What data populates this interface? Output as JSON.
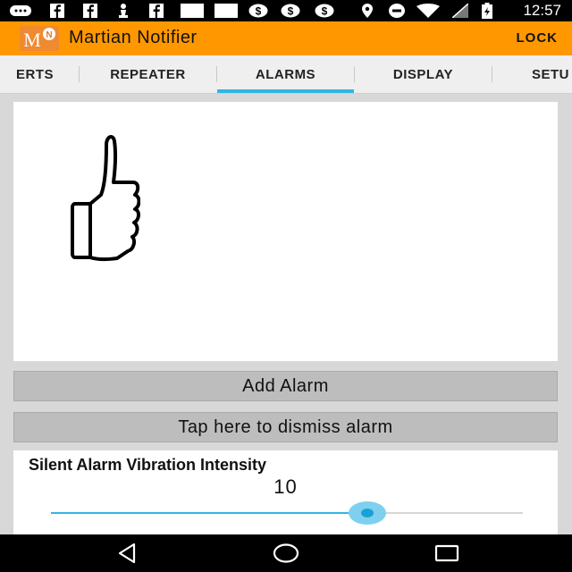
{
  "status_bar": {
    "time": "12:57",
    "icons": [
      "message-icon",
      "facebook-icon",
      "facebook-icon",
      "chess-icon",
      "facebook-icon",
      "image-icon",
      "image-icon",
      "dollar-icon",
      "dollar-icon",
      "dollar-icon",
      "location-icon",
      "minus-circle-icon",
      "wifi-icon",
      "signal-icon",
      "battery-icon"
    ]
  },
  "app_bar": {
    "logo_text": "M",
    "title": "Martian Notifier",
    "lock_label": "LOCK",
    "background": "#ff9800"
  },
  "tabs": [
    {
      "label": "ERTS"
    },
    {
      "label": "REPEATER"
    },
    {
      "label": "ALARMS",
      "selected": true
    },
    {
      "label": "DISPLAY"
    },
    {
      "label": "SETU"
    }
  ],
  "accent": "#33b5e5",
  "preview_icon": "thumbs-up-icon",
  "buttons": {
    "add_alarm": "Add Alarm",
    "dismiss": "Tap here to dismiss alarm"
  },
  "vibration": {
    "title": "Silent Alarm Vibration Intensity",
    "value": "10",
    "fraction": 0.67
  },
  "nav": [
    "back-icon",
    "home-icon",
    "recents-icon"
  ]
}
